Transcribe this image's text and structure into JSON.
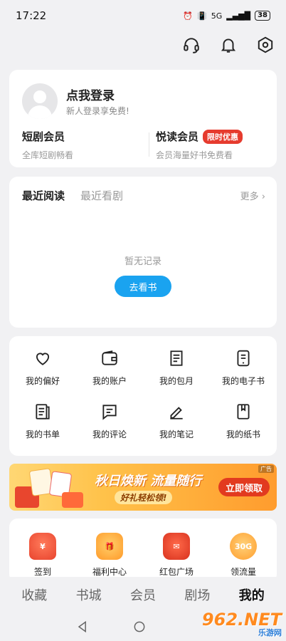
{
  "status_bar": {
    "time": "17:22",
    "network": "5G",
    "battery": "38"
  },
  "top_bar": {
    "icons": [
      "headset-icon",
      "bell-icon",
      "settings-icon"
    ]
  },
  "login": {
    "title": "点我登录",
    "subtitle": "新人登录享免费!"
  },
  "vip": {
    "short_drama": {
      "title": "短剧会员",
      "desc": "全库短剧畅看"
    },
    "reading": {
      "title": "悦读会员",
      "tag": "限时优惠",
      "desc": "会员海量好书免费看"
    }
  },
  "recent": {
    "tabs": [
      {
        "label": "最近阅读",
        "active": true
      },
      {
        "label": "最近看剧",
        "active": false
      }
    ],
    "more": "更多",
    "empty_text": "暂无记录",
    "action": "去看书"
  },
  "menu": {
    "items": [
      {
        "label": "我的偏好",
        "icon": "heart-icon"
      },
      {
        "label": "我的账户",
        "icon": "wallet-icon"
      },
      {
        "label": "我的包月",
        "icon": "subscription-icon"
      },
      {
        "label": "我的电子书",
        "icon": "ebook-icon"
      },
      {
        "label": "我的书单",
        "icon": "booklist-icon"
      },
      {
        "label": "我的评论",
        "icon": "comment-icon"
      },
      {
        "label": "我的笔记",
        "icon": "pen-icon"
      },
      {
        "label": "我的纸书",
        "icon": "paper-book-icon"
      }
    ]
  },
  "banner": {
    "ad_label": "广告",
    "title": "秋日焕新 流量随行",
    "subtitle": "好礼轻松领!",
    "button": "立即领取"
  },
  "benefits": {
    "items": [
      {
        "label": "签到",
        "icon": "sign-in-icon"
      },
      {
        "label": "福利中心",
        "icon": "gift-box-icon"
      },
      {
        "label": "红包广场",
        "icon": "red-packet-icon"
      },
      {
        "label": "领流量",
        "icon": "data-bonus-icon",
        "badge": "30G"
      }
    ]
  },
  "bottom_nav": {
    "items": [
      {
        "label": "收藏",
        "active": false
      },
      {
        "label": "书城",
        "active": false
      },
      {
        "label": "会员",
        "active": false
      },
      {
        "label": "剧场",
        "active": false
      },
      {
        "label": "我的",
        "active": true
      }
    ]
  },
  "watermark": {
    "text": "962.NET",
    "sub": "乐游网"
  },
  "colors": {
    "accent_blue": "#1aa3f0",
    "promo_red": "#e63b2e",
    "banner_orange": "#ffad3a"
  }
}
